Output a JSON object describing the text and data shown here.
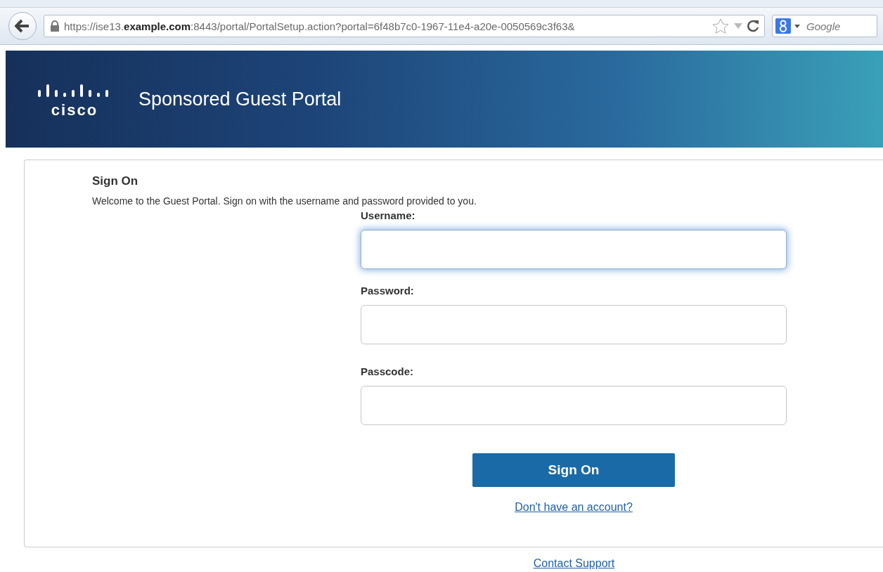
{
  "browser": {
    "url": "https://ise13.**example.com**:8443/portal/PortalSetup.action?portal=6f48b7c0-1967-11e4-a20e-0050569c3f63&",
    "search_engine_placeholder": "Google"
  },
  "header": {
    "logo_text": "cisco",
    "title": "Sponsored Guest Portal"
  },
  "form": {
    "heading": "Sign On",
    "intro": "Welcome to the Guest Portal. Sign on with the username and password provided to you.",
    "fields": [
      {
        "label": "Username:",
        "focused": true
      },
      {
        "label": "Password:",
        "focused": false
      },
      {
        "label": "Passcode:",
        "focused": false
      }
    ],
    "submit": "Sign On",
    "account_link": "Don't have an account?"
  },
  "footer_link": "Contact Support"
}
